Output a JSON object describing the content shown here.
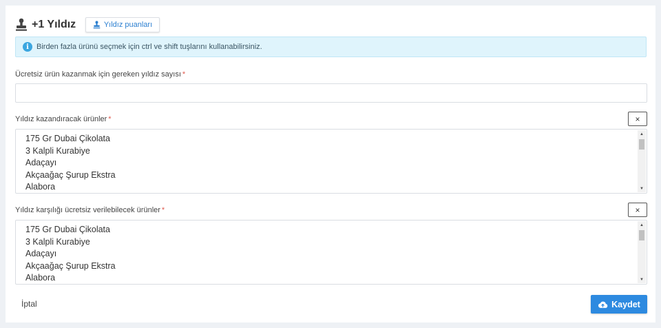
{
  "header": {
    "title": "+1 Yıldız",
    "points_button": "Yıldız puanları"
  },
  "info": {
    "icon": "info-icon",
    "text": "Birden fazla ürünü seçmek için ctrl ve shift tuşlarını kullanabilirsiniz."
  },
  "fields": {
    "star_count": {
      "label": "Ücretsiz ürün kazanmak için gereken yıldız sayısı",
      "required": "*",
      "value": "",
      "placeholder": ""
    },
    "earning_products": {
      "label": "Yıldız kazandıracak ürünler",
      "required": "*",
      "clear": "×",
      "options": [
        "175 Gr Dubai Çikolata",
        "3 Kalpli Kurabiye",
        "Adaçayı",
        "Akçaağaç Şurup Ekstra",
        "Alabora"
      ]
    },
    "free_products": {
      "label": "Yıldız karşılığı ücretsiz verilebilecek ürünler",
      "required": "*",
      "clear": "×",
      "options": [
        "175 Gr Dubai Çikolata",
        "3 Kalpli Kurabiye",
        "Adaçayı",
        "Akçaağaç Şurup Ekstra",
        "Alabora"
      ]
    }
  },
  "footer": {
    "cancel": "İptal",
    "save": "Kaydet"
  },
  "colors": {
    "accent": "#2d8ae0",
    "info_bg": "#dff4fc",
    "required": "#e05a4e"
  }
}
